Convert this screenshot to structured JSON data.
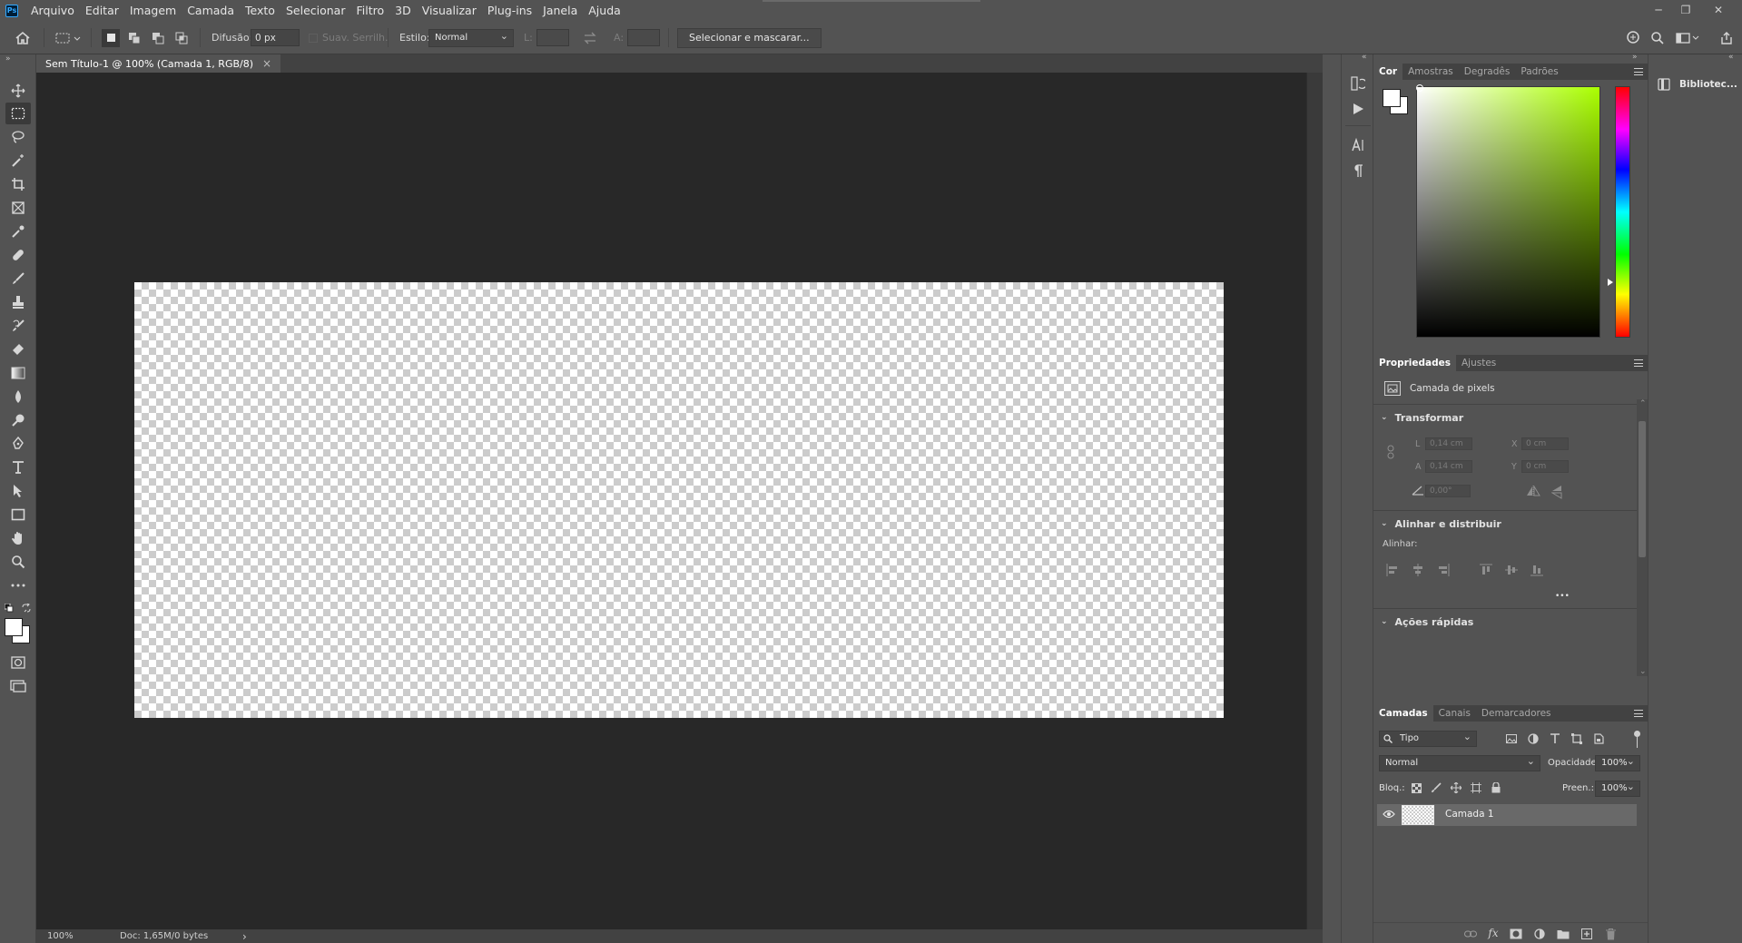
{
  "app": {
    "logo": "Ps"
  },
  "menu": [
    "Arquivo",
    "Editar",
    "Imagem",
    "Camada",
    "Texto",
    "Selecionar",
    "Filtro",
    "3D",
    "Visualizar",
    "Plug-ins",
    "Janela",
    "Ajuda"
  ],
  "window_controls": {
    "minimize": "─",
    "restore": "❐",
    "close": "✕"
  },
  "options": {
    "feather_label": "Difusão:",
    "feather_value": "0 px",
    "antialias_label": "Suav. Serrilh.",
    "style_label": "Estilo:",
    "style_value": "Normal",
    "width_label": "L:",
    "height_label": "A:",
    "select_mask_button": "Selecionar e mascarar..."
  },
  "document": {
    "tab_title": "Sem Título-1 @ 100% (Camada 1, RGB/8)",
    "close": "×"
  },
  "status": {
    "zoom": "100%",
    "doc_info": "Doc: 1,65M/0 bytes",
    "arrow": "›"
  },
  "color_panel": {
    "tabs": [
      "Cor",
      "Amostras",
      "Degradês",
      "Padrões"
    ],
    "hue_marker_hex": "#aaff00"
  },
  "properties_panel": {
    "tabs": [
      "Propriedades",
      "Ajustes"
    ],
    "layer_kind": "Camada de pixels",
    "transform": {
      "title": "Transformar",
      "w_label": "L",
      "w_value": "0,14 cm",
      "h_label": "A",
      "h_value": "0,14 cm",
      "x_label": "X",
      "x_value": "0 cm",
      "y_label": "Y",
      "y_value": "0 cm",
      "angle_value": "0,00°"
    },
    "align": {
      "title": "Alinhar e distribuir",
      "label": "Alinhar:",
      "more": "•••"
    },
    "quick_actions": {
      "title": "Ações rápidas"
    }
  },
  "layers_panel": {
    "tabs": [
      "Camadas",
      "Canais",
      "Demarcadores"
    ],
    "filter_value": "Tipo",
    "blend_mode": "Normal",
    "opacity_label": "Opacidade:",
    "opacity_value": "100%",
    "lock_label": "Bloq.:",
    "fill_label": "Preen.:",
    "fill_value": "100%",
    "layers": [
      {
        "name": "Camada 1"
      }
    ]
  },
  "libraries": {
    "label": "Bibliotec..."
  },
  "colors": {
    "accent": "#31a8ff",
    "bg_panel": "#535353",
    "bg_canvas": "#282828"
  }
}
